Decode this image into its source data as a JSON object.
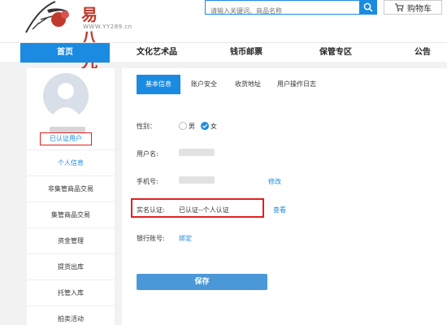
{
  "header": {
    "logo_text": "易八九",
    "logo_url": "WWW.YY289.cn",
    "search_placeholder": "请输入关键词、商品名称",
    "cart_label": "购物车"
  },
  "nav": {
    "items": [
      "首页",
      "文化艺术品",
      "钱币邮票",
      "保管专区",
      "公告"
    ]
  },
  "sidebar": {
    "verified_label": "已认证用户",
    "menu": [
      "个人信息",
      "非集管商品交易",
      "集管商品交易",
      "资金管理",
      "提货出库",
      "托管入库",
      "拍卖活动"
    ]
  },
  "main": {
    "tabs": [
      "基本信息",
      "账户安全",
      "收货地址",
      "用户操作日志"
    ],
    "gender_label": "性别：",
    "gender_options": [
      "男",
      "女"
    ],
    "gender_selected": "女",
    "username_label": "用户名:",
    "phone_label": "手机号:",
    "phone_modify": "修改",
    "realname_label": "实名认证:",
    "realname_value": "已认证--个人认证",
    "realname_view": "查看",
    "bank_label": "银行账号:",
    "bank_bind": "绑定",
    "save_label": "保存"
  },
  "colors": {
    "accent": "#1a8be0",
    "highlight_border": "#e02020"
  }
}
